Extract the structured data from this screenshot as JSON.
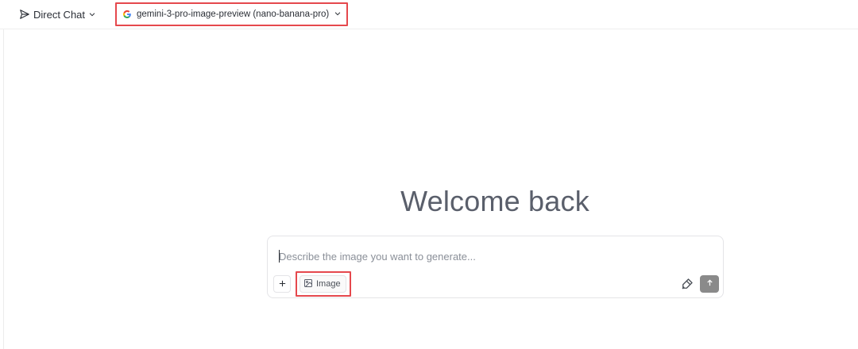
{
  "header": {
    "mode_label": "Direct Chat",
    "model_label": "gemini-3-pro-image-preview (nano-banana-pro)"
  },
  "main": {
    "welcome_text": "Welcome back"
  },
  "composer": {
    "placeholder": "Describe the image you want to generate...",
    "image_chip_label": "Image"
  },
  "colors": {
    "highlight": "#e5484d",
    "send_button": "#8a8a8a",
    "welcome_text": "#5a5f6b"
  },
  "icons": [
    "send-mode-icon",
    "chevron-down-icon",
    "google-icon",
    "plus-icon",
    "image-icon",
    "tools-icon",
    "arrow-up-icon"
  ]
}
